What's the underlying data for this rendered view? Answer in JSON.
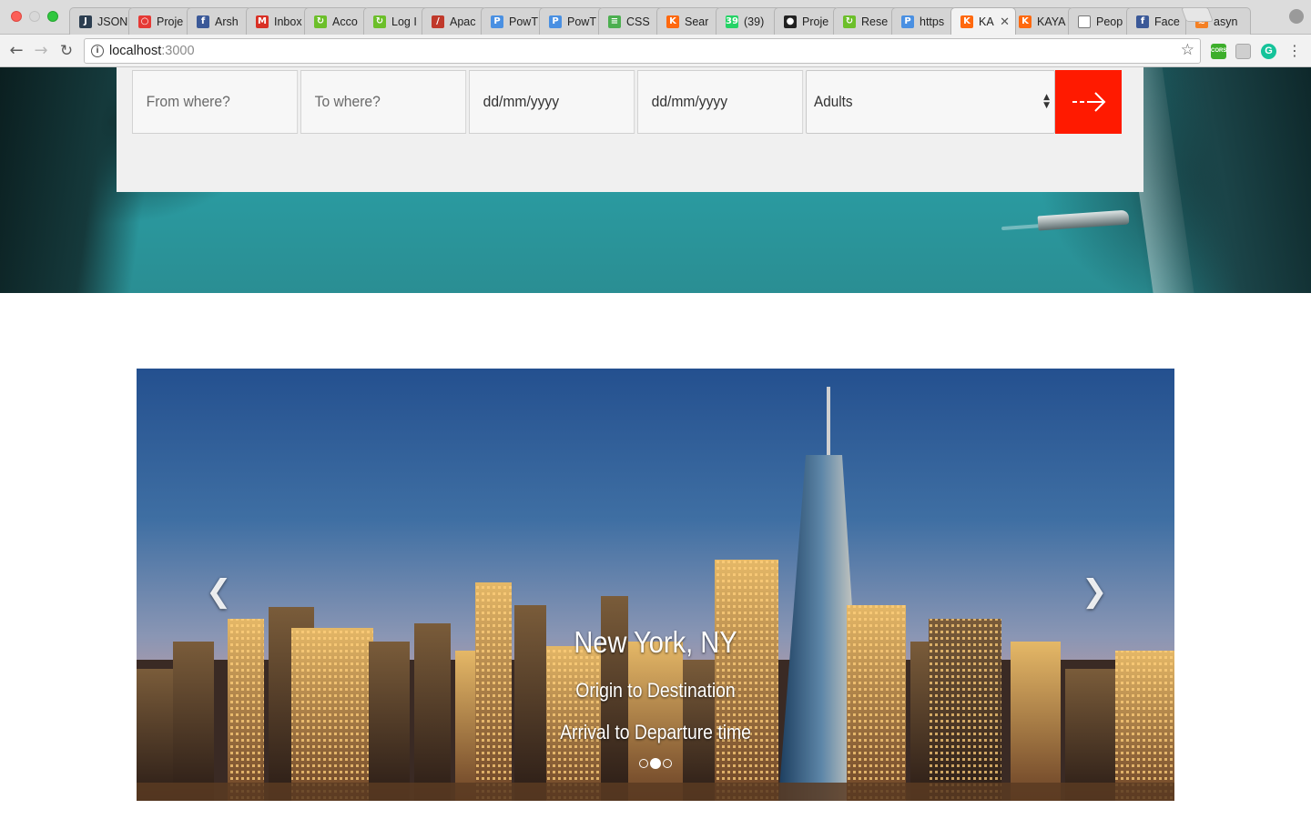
{
  "browser": {
    "tabs": [
      {
        "label": "JSON",
        "icon": "jsonlint-icon",
        "color": "#2c3e50"
      },
      {
        "label": "Proje",
        "icon": "lifesaver-icon",
        "color": "#e53935"
      },
      {
        "label": "Arsh",
        "icon": "facebook-icon",
        "color": "#3b5998"
      },
      {
        "label": "Inbox",
        "icon": "gmail-icon",
        "color": "#d93025"
      },
      {
        "label": "Acco",
        "icon": "green-swirl-icon",
        "color": "#6cbf2a"
      },
      {
        "label": "Log I",
        "icon": "green-swirl-icon",
        "color": "#6cbf2a"
      },
      {
        "label": "Apac",
        "icon": "apache-feather-icon",
        "color": "#c0392b"
      },
      {
        "label": "PowT",
        "icon": "powtoon-icon",
        "color": "#4a90e2"
      },
      {
        "label": "PowT",
        "icon": "powtoon-icon",
        "color": "#4a90e2"
      },
      {
        "label": "CSS",
        "icon": "css-icon",
        "color": "#4caf50"
      },
      {
        "label": "Sear",
        "icon": "kayak-icon",
        "color": "#ff690f"
      },
      {
        "label": "(39)",
        "icon": "whatsapp-icon",
        "color": "#25d366"
      },
      {
        "label": "Proje",
        "icon": "github-icon",
        "color": "#222222"
      },
      {
        "label": "Rese",
        "icon": "green-swirl-icon",
        "color": "#6cbf2a"
      },
      {
        "label": "https",
        "icon": "powtoon-icon",
        "color": "#4a90e2"
      },
      {
        "label": "KA",
        "icon": "kayak-icon",
        "color": "#ff690f",
        "active": true
      },
      {
        "label": "KAYA",
        "icon": "kayak-icon",
        "color": "#ff690f"
      },
      {
        "label": "Peop",
        "icon": "document-icon",
        "color": "#ffffff"
      },
      {
        "label": "Face",
        "icon": "facebook-icon",
        "color": "#3b5998"
      },
      {
        "label": "asyn",
        "icon": "stackoverflow-icon",
        "color": "#f48024"
      }
    ],
    "url_host": "localhost",
    "url_port": ":3000"
  },
  "search": {
    "from_placeholder": "From where?",
    "to_placeholder": "To where?",
    "depart_placeholder": "dd/mm/yyyy",
    "return_placeholder": "dd/mm/yyyy",
    "travellers_selected": "Adults",
    "go_color": "#ff1a00"
  },
  "carousel": {
    "city": "New York, NY",
    "route": "Origin to Destination",
    "times": "Arrival to Departure time",
    "slides": 3,
    "active_slide": 2
  }
}
